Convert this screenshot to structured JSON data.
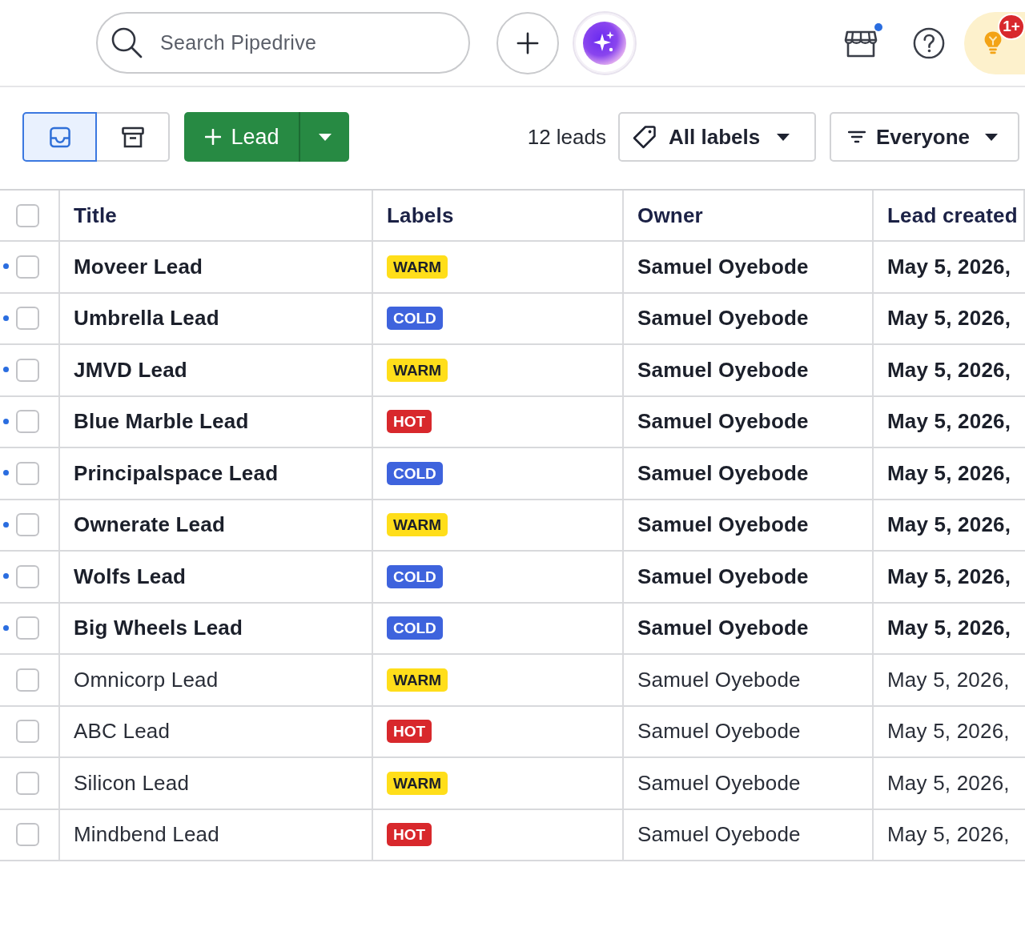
{
  "top_bar": {
    "search": {
      "placeholder": "Search Pipedrive"
    },
    "marketplace": {
      "notification": true
    },
    "tips": {
      "badge": "1+"
    }
  },
  "toolbar": {
    "views": [
      {
        "kind": "list",
        "selected": true
      },
      {
        "kind": "archive",
        "selected": false
      }
    ],
    "add_button": {
      "label": "Lead"
    },
    "count": "12 leads",
    "label_filter": {
      "label": "All labels"
    },
    "owner_filter": {
      "label": "Everyone"
    }
  },
  "table": {
    "select_all": {
      "checked": false
    },
    "columns": [
      "Title",
      "Labels",
      "Owner",
      "Lead created"
    ],
    "rows": [
      {
        "unread": true,
        "checked": false,
        "title": "Moveer Lead",
        "label": {
          "text": "WARM",
          "color": "#ffde1a"
        },
        "owner": "Samuel Oyebode",
        "created": "May 5, 2026,"
      },
      {
        "unread": true,
        "checked": false,
        "title": "Umbrella Lead",
        "label": {
          "text": "COLD",
          "color": "#3e63dd"
        },
        "owner": "Samuel Oyebode",
        "created": "May 5, 2026,"
      },
      {
        "unread": true,
        "checked": false,
        "title": "JMVD Lead",
        "label": {
          "text": "WARM",
          "color": "#ffde1a"
        },
        "owner": "Samuel Oyebode",
        "created": "May 5, 2026,"
      },
      {
        "unread": true,
        "checked": false,
        "title": "Blue Marble Lead",
        "label": {
          "text": "HOT",
          "color": "#d8282c"
        },
        "owner": "Samuel Oyebode",
        "created": "May 5, 2026,"
      },
      {
        "unread": true,
        "checked": false,
        "title": "Principalspace Lead",
        "label": {
          "text": "COLD",
          "color": "#3e63dd"
        },
        "owner": "Samuel Oyebode",
        "created": "May 5, 2026,"
      },
      {
        "unread": true,
        "checked": false,
        "title": "Ownerate Lead",
        "label": {
          "text": "WARM",
          "color": "#ffde1a"
        },
        "owner": "Samuel Oyebode",
        "created": "May 5, 2026,"
      },
      {
        "unread": true,
        "checked": false,
        "title": "Wolfs Lead",
        "label": {
          "text": "COLD",
          "color": "#3e63dd"
        },
        "owner": "Samuel Oyebode",
        "created": "May 5, 2026,"
      },
      {
        "unread": true,
        "checked": false,
        "title": "Big Wheels Lead",
        "label": {
          "text": "COLD",
          "color": "#3e63dd"
        },
        "owner": "Samuel Oyebode",
        "created": "May 5, 2026,"
      },
      {
        "unread": false,
        "checked": false,
        "title": "Omnicorp Lead",
        "label": {
          "text": "WARM",
          "color": "#ffde1a"
        },
        "owner": "Samuel Oyebode",
        "created": "May 5, 2026,"
      },
      {
        "unread": false,
        "checked": false,
        "title": "ABC Lead",
        "label": {
          "text": "HOT",
          "color": "#d8282c"
        },
        "owner": "Samuel Oyebode",
        "created": "May 5, 2026,"
      },
      {
        "unread": false,
        "checked": false,
        "title": "Silicon Lead",
        "label": {
          "text": "WARM",
          "color": "#ffde1a"
        },
        "owner": "Samuel Oyebode",
        "created": "May 5, 2026,"
      },
      {
        "unread": false,
        "checked": false,
        "title": "Mindbend Lead",
        "label": {
          "text": "HOT",
          "color": "#d8282c"
        },
        "owner": "Samuel Oyebode",
        "created": "May 5, 2026,"
      }
    ]
  }
}
